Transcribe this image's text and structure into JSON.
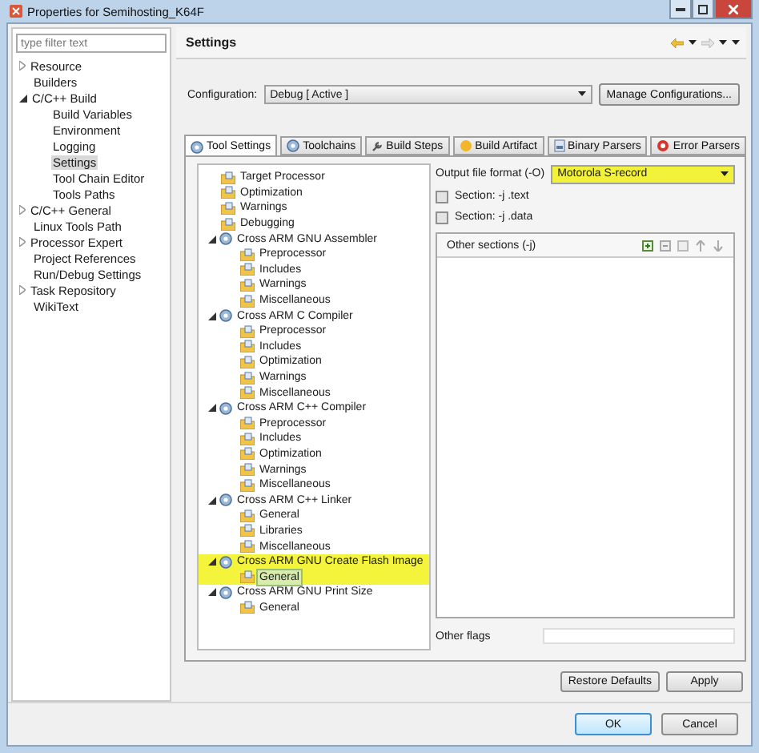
{
  "window": {
    "title": "Properties for Semihosting_K64F"
  },
  "filter": {
    "placeholder": "type filter text"
  },
  "nav": [
    {
      "label": "Resource",
      "expanded": false,
      "selected": false
    },
    {
      "label": "Builders",
      "selected": false
    },
    {
      "label": "C/C++ Build",
      "expanded": true,
      "selected": false,
      "children": [
        {
          "label": "Build Variables",
          "selected": false
        },
        {
          "label": "Environment",
          "selected": false
        },
        {
          "label": "Logging",
          "selected": false
        },
        {
          "label": "Settings",
          "selected": true
        },
        {
          "label": "Tool Chain Editor",
          "selected": false
        },
        {
          "label": "Tools Paths",
          "selected": false
        }
      ]
    },
    {
      "label": "C/C++ General",
      "expanded": false,
      "selected": false
    },
    {
      "label": "Linux Tools Path",
      "selected": false
    },
    {
      "label": "Processor Expert",
      "expanded": false,
      "selected": false
    },
    {
      "label": "Project References",
      "selected": false
    },
    {
      "label": "Run/Debug Settings",
      "selected": false
    },
    {
      "label": "Task Repository",
      "expanded": false,
      "selected": false
    },
    {
      "label": "WikiText",
      "selected": false
    }
  ],
  "page_title": "Settings",
  "configuration": {
    "label": "Configuration:",
    "value": "Debug  [ Active ]",
    "button": "Manage Configurations..."
  },
  "tabs": [
    {
      "label": "Tool Settings",
      "kind": "gear",
      "selected": true
    },
    {
      "label": "Toolchains",
      "kind": "gear",
      "selected": false
    },
    {
      "label": "Build Steps",
      "kind": "wrench",
      "selected": false
    },
    {
      "label": "Build Artifact",
      "kind": "artifact",
      "selected": false
    },
    {
      "label": "Binary Parsers",
      "kind": "binary",
      "selected": false
    },
    {
      "label": "Error Parsers",
      "kind": "error",
      "selected": false
    }
  ],
  "tree": [
    {
      "label": "Target Processor",
      "kind": "option",
      "selected": false,
      "highlighted": false
    },
    {
      "label": "Optimization",
      "kind": "option",
      "selected": false,
      "highlighted": false
    },
    {
      "label": "Warnings",
      "kind": "option",
      "selected": false,
      "highlighted": false
    },
    {
      "label": "Debugging",
      "kind": "option",
      "selected": false,
      "highlighted": false
    },
    {
      "label": "Cross ARM GNU Assembler",
      "kind": "tool",
      "expanded": true,
      "selected": false,
      "highlighted": false,
      "children": [
        {
          "label": "Preprocessor",
          "kind": "option",
          "selected": false,
          "highlighted": false
        },
        {
          "label": "Includes",
          "kind": "option",
          "selected": false,
          "highlighted": false
        },
        {
          "label": "Warnings",
          "kind": "option",
          "selected": false,
          "highlighted": false
        },
        {
          "label": "Miscellaneous",
          "kind": "option",
          "selected": false,
          "highlighted": false
        }
      ]
    },
    {
      "label": "Cross ARM C Compiler",
      "kind": "tool",
      "expanded": true,
      "selected": false,
      "highlighted": false,
      "children": [
        {
          "label": "Preprocessor",
          "kind": "option",
          "selected": false,
          "highlighted": false
        },
        {
          "label": "Includes",
          "kind": "option",
          "selected": false,
          "highlighted": false
        },
        {
          "label": "Optimization",
          "kind": "option",
          "selected": false,
          "highlighted": false
        },
        {
          "label": "Warnings",
          "kind": "option",
          "selected": false,
          "highlighted": false
        },
        {
          "label": "Miscellaneous",
          "kind": "option",
          "selected": false,
          "highlighted": false
        }
      ]
    },
    {
      "label": "Cross ARM C++ Compiler",
      "kind": "tool",
      "expanded": true,
      "selected": false,
      "highlighted": false,
      "children": [
        {
          "label": "Preprocessor",
          "kind": "option",
          "selected": false,
          "highlighted": false
        },
        {
          "label": "Includes",
          "kind": "option",
          "selected": false,
          "highlighted": false
        },
        {
          "label": "Optimization",
          "kind": "option",
          "selected": false,
          "highlighted": false
        },
        {
          "label": "Warnings",
          "kind": "option",
          "selected": false,
          "highlighted": false
        },
        {
          "label": "Miscellaneous",
          "kind": "option",
          "selected": false,
          "highlighted": false
        }
      ]
    },
    {
      "label": "Cross ARM C++ Linker",
      "kind": "tool",
      "expanded": true,
      "selected": false,
      "highlighted": false,
      "children": [
        {
          "label": "General",
          "kind": "option",
          "selected": false,
          "highlighted": false
        },
        {
          "label": "Libraries",
          "kind": "option",
          "selected": false,
          "highlighted": false
        },
        {
          "label": "Miscellaneous",
          "kind": "option",
          "selected": false,
          "highlighted": false
        }
      ]
    },
    {
      "label": "Cross ARM GNU Create Flash Image",
      "kind": "tool",
      "expanded": true,
      "selected": false,
      "highlighted": true,
      "children": [
        {
          "label": "General",
          "kind": "option",
          "selected": true,
          "highlighted": true
        }
      ]
    },
    {
      "label": "Cross ARM GNU Print Size",
      "kind": "tool",
      "expanded": true,
      "selected": false,
      "highlighted": false,
      "children": [
        {
          "label": "General",
          "kind": "option",
          "selected": false,
          "highlighted": false
        }
      ]
    }
  ],
  "output_format": {
    "label": "Output file format (-O)",
    "value": "Motorola S-record",
    "highlighted": true
  },
  "sections": [
    {
      "label": "Section: -j .text",
      "checked": false
    },
    {
      "label": "Section: -j .data",
      "checked": false
    }
  ],
  "other_sections": {
    "label": "Other sections (-j)"
  },
  "other_flags": {
    "label": "Other flags"
  },
  "page_buttons": [
    "Restore Defaults",
    "Apply"
  ],
  "dialog_buttons": [
    {
      "label": "OK",
      "default": true
    },
    {
      "label": "Cancel",
      "default": false
    }
  ]
}
